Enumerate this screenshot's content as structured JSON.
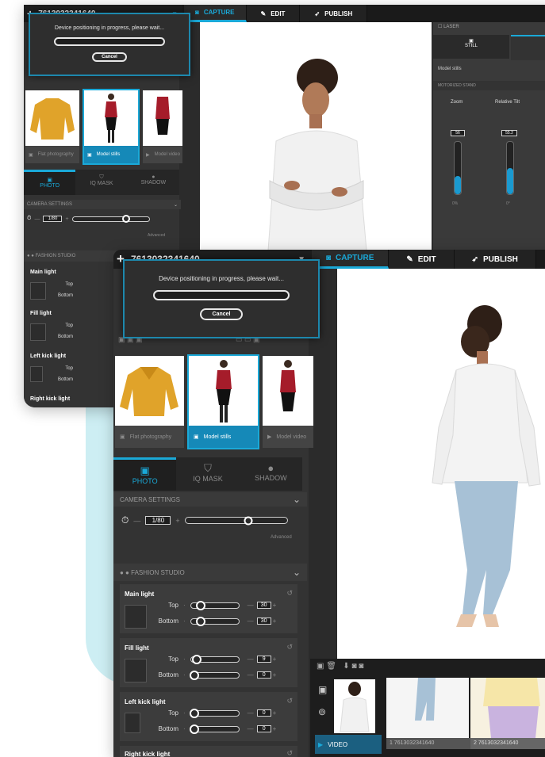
{
  "back": {
    "product_id": "7613032341640",
    "tabs": [
      {
        "label": "CAPTURE",
        "icon": "camera-icon"
      },
      {
        "label": "EDIT",
        "icon": "edit-icon"
      },
      {
        "label": "PUBLISH",
        "icon": "rocket-icon"
      }
    ],
    "dialog": {
      "message": "Device positioning in progress, please wait...",
      "cancel": "Cancel"
    },
    "thumbs": [
      {
        "caption": "Flat photography"
      },
      {
        "caption": "Model stills"
      },
      {
        "caption": "Model video"
      }
    ],
    "modes": [
      "PHOTO",
      "IQ MASK",
      "SHADOW"
    ],
    "camera_settings": "CAMERA SETTINGS",
    "shutter": "1/80",
    "advanced": "Advanced",
    "fashion_studio": "FASHION STUDIO",
    "lights": [
      {
        "title": "Main light",
        "top_label": "Top",
        "bottom_label": "Bottom"
      },
      {
        "title": "Fill light",
        "top_label": "Top",
        "bottom_label": "Bottom"
      },
      {
        "title": "Left kick light",
        "top_label": "Top",
        "bottom_label": "Bottom"
      },
      {
        "title": "Right kick light"
      }
    ],
    "right_panel": {
      "laser": "LASER",
      "still": "STILL",
      "model_stills": "Model stills",
      "motorized_stand": "MOTORIZED STAND",
      "zoom": {
        "label": "Zoom",
        "value": "56",
        "bottom": "0%",
        "level": 0.35
      },
      "tilt": {
        "label": "Relative Tilt",
        "value": "55.2",
        "bottom": "0°",
        "level": 0.5
      }
    }
  },
  "front": {
    "product_id": "7613032341640",
    "tabs": [
      {
        "label": "CAPTURE",
        "icon": "camera-icon"
      },
      {
        "label": "EDIT",
        "icon": "edit-icon"
      },
      {
        "label": "PUBLISH",
        "icon": "rocket-icon"
      }
    ],
    "dialog": {
      "message": "Device positioning in progress, please wait...",
      "cancel": "Cancel"
    },
    "thumbs": [
      {
        "caption": "Flat photography"
      },
      {
        "caption": "Model stills"
      },
      {
        "caption": "Model video"
      }
    ],
    "modes": [
      "PHOTO",
      "IQ MASK",
      "SHADOW"
    ],
    "camera_settings": "CAMERA SETTINGS",
    "shutter": "1/80",
    "advanced": "Advanced",
    "fashion_studio": "FASHION STUDIO",
    "lights": [
      {
        "title": "Main light",
        "top_label": "Top",
        "top_value": "30",
        "top_level": 0.15,
        "bottom_label": "Bottom",
        "bottom_value": "30",
        "bottom_level": 0.15
      },
      {
        "title": "Fill light",
        "top_label": "Top",
        "top_value": "9",
        "top_level": 0.05,
        "bottom_label": "Bottom",
        "bottom_value": "0",
        "bottom_level": 0.0
      },
      {
        "title": "Left kick light",
        "top_label": "Top",
        "top_value": "0",
        "top_level": 0.0,
        "bottom_label": "Bottom",
        "bottom_value": "0",
        "bottom_level": 0.0
      },
      {
        "title": "Right kick light"
      }
    ],
    "filmstrip": [
      {
        "label": "1 7613032341640"
      },
      {
        "label": "2 7613032341640"
      }
    ],
    "video_label": "VIDEO"
  }
}
